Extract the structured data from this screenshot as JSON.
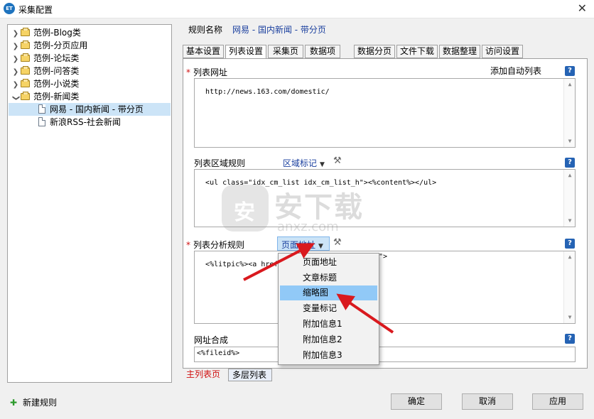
{
  "window": {
    "title": "采集配置",
    "app_icon_text": "ET",
    "close_glyph": "✕"
  },
  "tree": {
    "items": [
      {
        "label": "范例-Blog类",
        "type": "folder",
        "expanded": false
      },
      {
        "label": "范例-分页应用",
        "type": "folder",
        "expanded": false
      },
      {
        "label": "范例-论坛类",
        "type": "folder",
        "expanded": false
      },
      {
        "label": "范例-问答类",
        "type": "folder",
        "expanded": false
      },
      {
        "label": "范例-小说类",
        "type": "folder",
        "expanded": false
      },
      {
        "label": "范例-新闻类",
        "type": "folder",
        "expanded": true
      },
      {
        "label": "网易 - 国内新闻 - 带分页",
        "type": "doc",
        "selected": true
      },
      {
        "label": "新浪RSS-社会新闻",
        "type": "doc",
        "selected": false
      }
    ]
  },
  "new_rule_label": "新建规则",
  "rule_name": {
    "label": "规则名称",
    "value": "网易 - 国内新闻 - 带分页"
  },
  "tabs": [
    "基本设置",
    "列表设置",
    "采集页",
    "数据项",
    "数据分页",
    "文件下载",
    "数据整理",
    "访问设置"
  ],
  "active_tab": "列表设置",
  "list_url": {
    "label": "列表网址",
    "add_auto_list": "添加自动列表",
    "value": "http://news.163.com/domestic/"
  },
  "list_region": {
    "label": "列表区域规则",
    "marker": "区域标记",
    "value": "<ul class=\"idx_cm_list idx_cm_list_h\"><%content%></ul>"
  },
  "list_parse": {
    "label": "列表分析规则",
    "marker": "页面地址",
    "value": "<%litpic%><a href=\"",
    "value_tail": "\">"
  },
  "url_compose": {
    "label": "网址合成",
    "value": "<%fileid%>"
  },
  "help_glyph": "?",
  "menu": {
    "items": [
      "页面地址",
      "文章标题",
      "缩略图",
      "变量标记",
      "附加信息1",
      "附加信息2",
      "附加信息3"
    ],
    "highlighted": "缩略图"
  },
  "bottom_tabs": {
    "main": "主列表页",
    "multi": "多层列表"
  },
  "buttons": {
    "ok": "确定",
    "cancel": "取消",
    "apply": "应用"
  },
  "watermark": {
    "cn": "安下载",
    "en": "anxz.com",
    "shield": "安"
  },
  "colors": {
    "link_blue": "#1a3f9e",
    "required_red": "#d01010",
    "menu_highlight": "#91c9f7",
    "arrow_red": "#d9191e"
  }
}
